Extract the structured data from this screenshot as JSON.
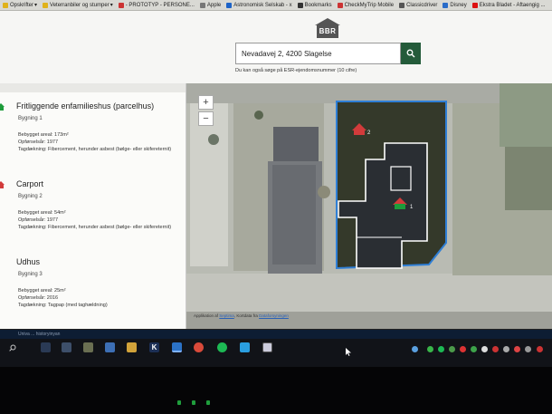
{
  "bookmarks": [
    {
      "label": "Opskrifter",
      "color": "#e0b21b",
      "caret": true
    },
    {
      "label": "Veterranbiler og stumper",
      "color": "#e0b21b",
      "caret": true
    },
    {
      "label": "- PROTOTYP - PERSONE...",
      "color": "#c33",
      "caret": false
    },
    {
      "label": "Apple",
      "color": "#777",
      "caret": false
    },
    {
      "label": "Astronomisk Selskab - x",
      "color": "#1d63c7",
      "caret": false
    },
    {
      "label": "Bookmarks",
      "color": "#333",
      "caret": false
    },
    {
      "label": "CheckMyTrip Mobile",
      "color": "#c33",
      "caret": false
    },
    {
      "label": "Classicdriver",
      "color": "#555",
      "caret": false
    },
    {
      "label": "Disney",
      "color": "#2a6cc8",
      "caret": false
    },
    {
      "label": "Ekstra Bladet - Aftaengig ...",
      "color": "#d11",
      "caret": false
    }
  ],
  "header": {
    "logo_text": "BBR",
    "search_value": "Nevadavej 2, 4200 Slagelse",
    "hint": "Du kan også søge på ESR-ejendomsnummer (10 cifre)"
  },
  "sidebar": {
    "buildings": [
      {
        "title": "Fritliggende enfamilieshus (parcelhus)",
        "number": "Bygning 1",
        "lines": [
          "Bebygget areal: 173m²",
          "Opførselsår: 1977",
          "Tagdækning: Fibercement, herunder asbest (bølge- eller skifereternit)"
        ]
      },
      {
        "title": "Carport",
        "number": "Bygning 2",
        "lines": [
          "Bebygget areal: 54m²",
          "Opførselsår: 1977",
          "Tagdækning: Fibercement, herunder asbest (bølge- eller skifereternit)"
        ]
      },
      {
        "title": "Udhus",
        "number": "Bygning 3",
        "lines": [
          "Bebygget areal: 25m²",
          "Opførselsår: 2016",
          "Tagdækning: Tagpap (med taghældning)"
        ]
      }
    ]
  },
  "map": {
    "zoom_in": "+",
    "zoom_out": "−",
    "attribution_prefix": "Applikation af",
    "attribution_link1": "Septima",
    "attribution_mid": ", Kortdata fra",
    "attribution_link2": "Dataforsyningen",
    "marker_labels": [
      "2",
      "1"
    ],
    "parcel_color": "#2f7fd6"
  },
  "taskbar": {
    "strip_text": "Univa ...   historyinyan"
  }
}
